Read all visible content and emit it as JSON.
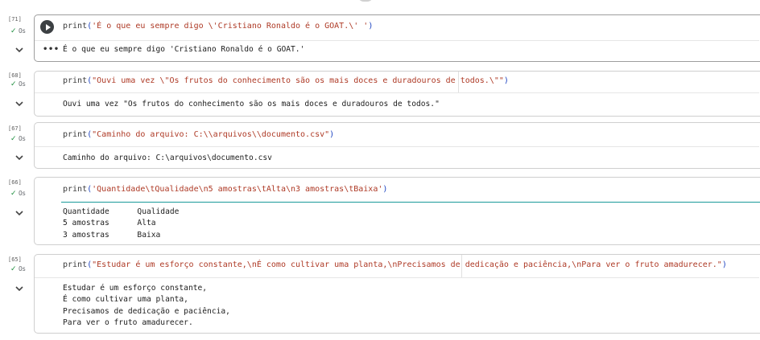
{
  "cells": [
    {
      "exec_count": "[71]",
      "status_time": "0s",
      "code_fn": "print",
      "code_open": "(",
      "code_str": "'É o que eu sempre digo \\'Cristiano Ronaldo é o GOAT.\\' '",
      "code_close": ")",
      "output": "É o que eu sempre digo 'Cristiano Ronaldo é o GOAT.'"
    },
    {
      "exec_count": "[68]",
      "status_time": "0s",
      "code_fn": "print",
      "code_open": "(",
      "code_str": "\"Ouvi uma vez \\\"Os frutos do conhecimento são os mais doces e duradouros de todos.\\\"\"",
      "code_close": ")",
      "output": "Ouvi uma vez \"Os frutos do conhecimento são os mais doces e duradouros de todos.\""
    },
    {
      "exec_count": "[67]",
      "status_time": "0s",
      "code_fn": "print",
      "code_open": "(",
      "code_str": "\"Caminho do arquivo: C:\\\\arquivos\\\\documento.csv\"",
      "code_close": ")",
      "output": "Caminho do arquivo: C:\\arquivos\\documento.csv"
    },
    {
      "exec_count": "[66]",
      "status_time": "0s",
      "code_fn": "print",
      "code_open": "(",
      "code_str": "'Quantidade\\tQualidade\\n5 amostras\\tAlta\\n3 amostras\\tBaixa'",
      "code_close": ")",
      "output": "Quantidade      Qualidade\n5 amostras      Alta\n3 amostras      Baixa"
    },
    {
      "exec_count": "[65]",
      "status_time": "0s",
      "code_fn": "print",
      "code_open": "(",
      "code_str": "\"Estudar é um esforço constante,\\nÉ como cultivar uma planta,\\nPrecisamos de dedicação e paciência,\\nPara ver o fruto amadurecer.\"",
      "code_close": ")",
      "output": "Estudar é um esforço constante,\nÉ como cultivar uma planta,\nPrecisamos de dedicação e paciência,\nPara ver o fruto amadurecer."
    }
  ],
  "colors": {
    "string": "#ae3a26",
    "function": "#3b3b3b",
    "paren": "#1f45c2",
    "check": "#1e8e3e",
    "focus_line": "#1a9a9a"
  },
  "icons": {
    "run": "play-circle-icon",
    "collapse": "chevron-down-icon",
    "output_menu": "more-horiz-icon",
    "status": "check-icon"
  }
}
